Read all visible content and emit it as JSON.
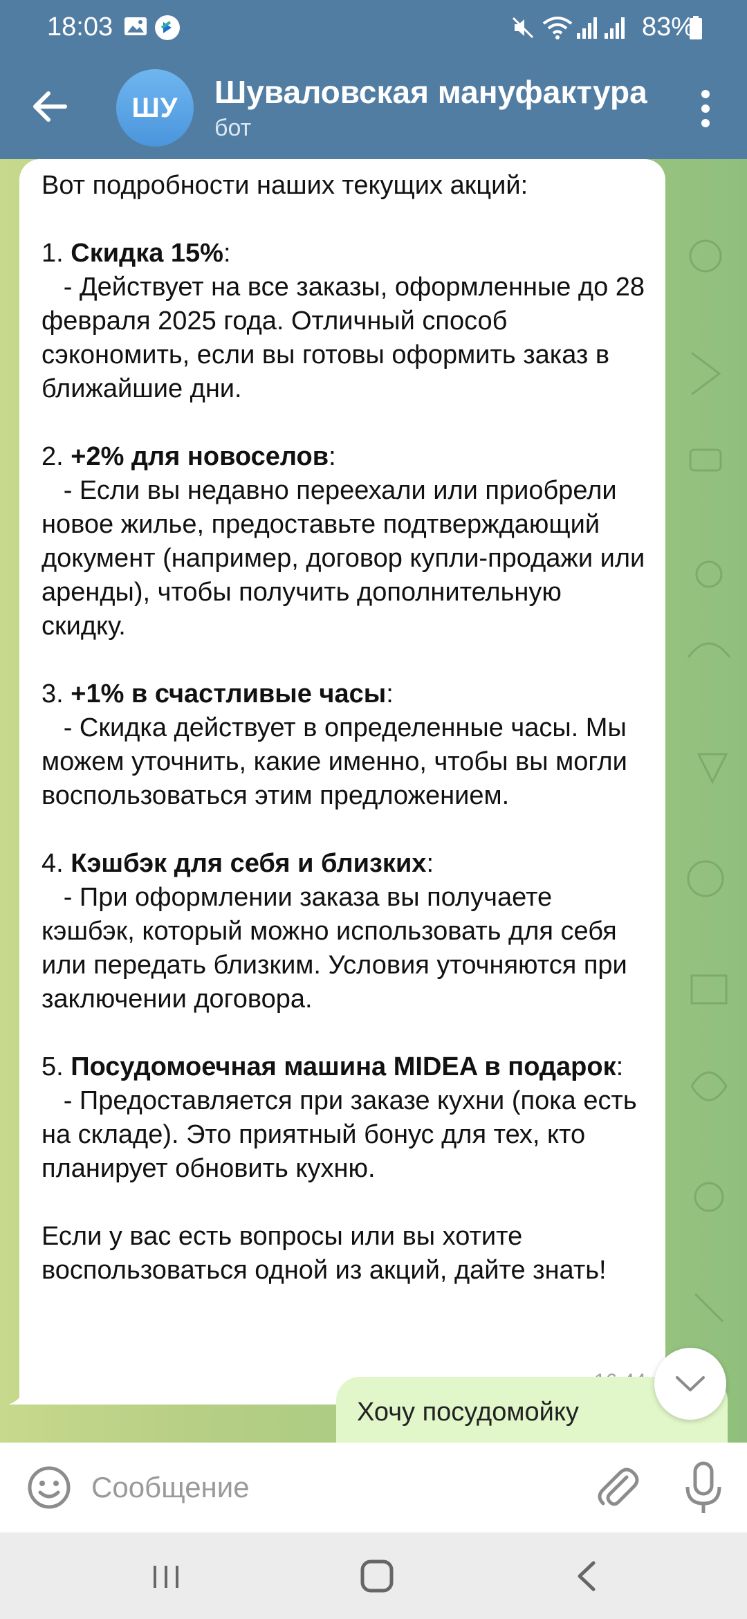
{
  "status_bar": {
    "time": "18:03",
    "battery": "83%",
    "icons": [
      "gallery-icon",
      "app-notification-icon",
      "mute-icon",
      "wifi-icon",
      "signal-icon",
      "signal-icon",
      "battery-icon"
    ]
  },
  "header": {
    "avatar_initials": "ШУ",
    "title": "Шуваловская мануфактура",
    "subtitle": "бот"
  },
  "message": {
    "intro": "Вот подробности наших текущих акций:",
    "items": [
      {
        "num": "1. ",
        "title": "Скидка 15%",
        "body": ":\n   - Действует на все заказы, оформленные до 28 февраля 2025 года. Отличный способ сэкономить, если вы готовы оформить заказ в ближайшие дни."
      },
      {
        "num": "2. ",
        "title": "+2% для новоселов",
        "body": ":\n   - Если вы недавно переехали или приобрели новое жилье, предоставьте подтверждающий документ (например, договор купли-продажи или аренды), чтобы получить дополнительную скидку."
      },
      {
        "num": "3. ",
        "title": "+1% в счастливые часы",
        "body": ":\n   - Скидка действует в определенные часы. Мы можем уточнить, какие именно, чтобы вы могли воспользоваться этим предложением."
      },
      {
        "num": "4. ",
        "title": "Кэшбэк для себя и близких",
        "body": ":\n   - При оформлении заказа вы получаете кэшбэк, который можно использовать для себя или передать близким. Условия уточняются при заключении договора."
      },
      {
        "num": "5. ",
        "title": "Посудомоечная машина MIDEA в подарок",
        "body": ":\n   - Предоставляется при заказе кухни (пока есть на складе). Это приятный бонус для тех, кто планирует обновить кухню."
      }
    ],
    "outro": "Если у вас есть вопросы или вы хотите воспользоваться одной из акций, дайте знать!",
    "time": "16:44"
  },
  "next_message": {
    "text": "Хочу посудомойку"
  },
  "input": {
    "placeholder": "Сообщение"
  },
  "colors": {
    "header_bg": "#527da3",
    "bubble_out": "#e1f7c9",
    "bubble_in": "#ffffff"
  }
}
